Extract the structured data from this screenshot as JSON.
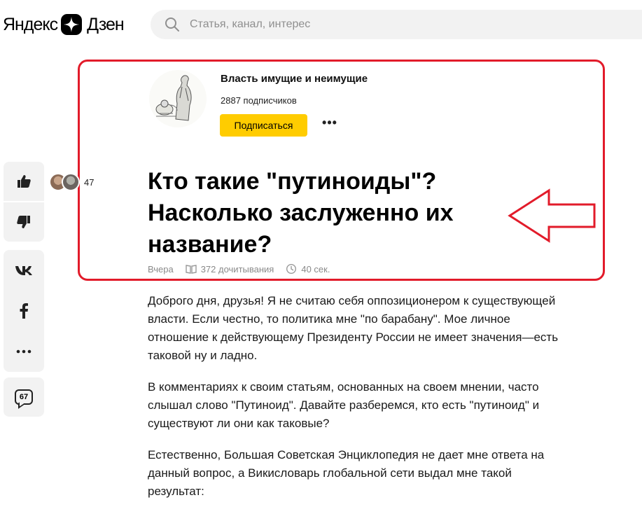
{
  "header": {
    "logo_left": "Яндекс",
    "logo_right": "Дзен",
    "search_placeholder": "Статья, канал, интерес"
  },
  "channel": {
    "name": "Власть имущие и неимущие",
    "subscribers": "2887 подписчиков",
    "subscribe_label": "Подписаться",
    "more_label": "•••"
  },
  "article": {
    "title": "Кто такие \"путиноиды\"? Насколько заслуженно их название?",
    "date": "Вчера",
    "reads": "372 дочитывания",
    "read_time": "40 сек.",
    "paragraphs": [
      "Доброго дня, друзья! Я не считаю себя оппозиционером к существующей власти. Если честно, то политика мне \"по барабану\". Мое личное отношение к действующему Президенту России не имеет значения—есть таковой ну и ладно.",
      "В комментариях к своим статьям, основанных на своем мнении, часто слышал слово \"Путиноид\". Давайте разберемся, кто есть \"путиноид\" и существуют ли они как таковые?",
      "Естественно, Большая Советская Энциклопедия не дает мне ответа на данный вопрос, а Викисловарь глобальной сети выдал мне такой результат:"
    ]
  },
  "sidebar": {
    "likes_count": "47",
    "comments_count": "67"
  },
  "colors": {
    "accent_yellow": "#ffcc00",
    "highlight_red": "#e21b2a",
    "panel_gray": "#f2f2f2"
  },
  "icons": [
    "search-icon",
    "like-icon",
    "dislike-icon",
    "vk-icon",
    "facebook-icon",
    "more-icon",
    "comments-icon",
    "book-icon",
    "clock-icon",
    "arrow-annotation"
  ]
}
